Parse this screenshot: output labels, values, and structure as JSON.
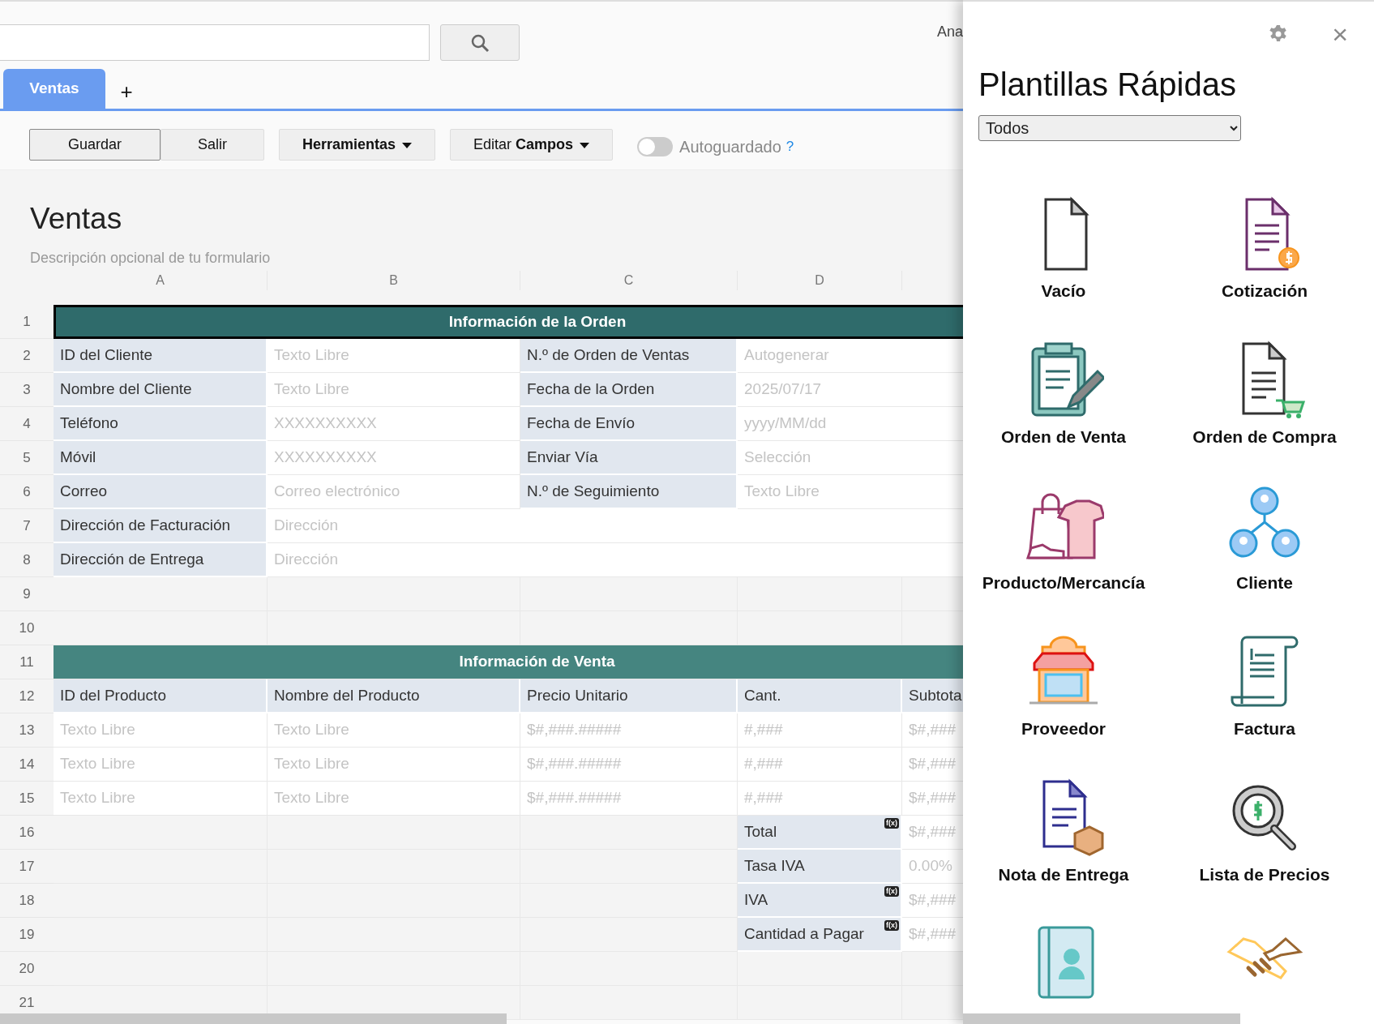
{
  "topbar": {
    "user": "Ana"
  },
  "tabs": [
    {
      "label": "Ventas",
      "selected": true
    }
  ],
  "add_tab": "+",
  "toolbar": [
    {
      "kind": "primary",
      "label": "Guardar"
    },
    {
      "kind": "plain",
      "label": "Salir"
    },
    {
      "kind": "dropdown",
      "label": "Herramientas"
    },
    {
      "kind": "dropdown-mixed",
      "label": "Editar **Campos**"
    }
  ],
  "autosave": {
    "label": "Autoguardado",
    "on": false,
    "help": "?"
  },
  "form": {
    "title": "Ventas",
    "description": "Descripción opcional de tu formulario"
  },
  "sheet": {
    "columns": [
      "A",
      "B",
      "C",
      "D",
      ""
    ],
    "rows": [
      {
        "number": "1",
        "cells": [
          {
            "kind": "section",
            "text": "Información de la Orden",
            "color": "#2f6b6b",
            "selected": true
          }
        ]
      },
      {
        "number": "2",
        "cells": [
          {
            "kind": "label",
            "text": "ID del Cliente"
          },
          {
            "kind": "input",
            "text": "Texto Libre"
          },
          {
            "kind": "label",
            "text": "N.º de Orden de Ventas"
          },
          {
            "kind": "wide_input",
            "text": "Autogenerar"
          }
        ]
      },
      {
        "number": "3",
        "cells": [
          {
            "kind": "label",
            "text": "Nombre del Cliente"
          },
          {
            "kind": "input",
            "text": "Texto Libre"
          },
          {
            "kind": "label",
            "text": "Fecha de la Orden"
          },
          {
            "kind": "wide_input",
            "text": "2025/07/17"
          }
        ]
      },
      {
        "number": "4",
        "cells": [
          {
            "kind": "label",
            "text": "Teléfono"
          },
          {
            "kind": "input",
            "text": "XXXXXXXXXX"
          },
          {
            "kind": "label",
            "text": "Fecha de Envío"
          },
          {
            "kind": "wide_input",
            "text": "yyyy/MM/dd"
          }
        ]
      },
      {
        "number": "5",
        "cells": [
          {
            "kind": "label",
            "text": "Móvil"
          },
          {
            "kind": "input",
            "text": "XXXXXXXXXX"
          },
          {
            "kind": "label",
            "text": "Enviar Vía"
          },
          {
            "kind": "wide_input",
            "text": "Selección"
          }
        ]
      },
      {
        "number": "6",
        "cells": [
          {
            "kind": "label",
            "text": "Correo"
          },
          {
            "kind": "input",
            "text": "Correo electrónico"
          },
          {
            "kind": "label",
            "text": "N.º de Seguimiento"
          },
          {
            "kind": "wide_input",
            "text": "Texto Libre"
          }
        ]
      },
      {
        "number": "7",
        "cells": [
          {
            "kind": "label",
            "text": "Dirección de Facturación"
          },
          {
            "kind": "wide_input",
            "text": "Dirección"
          }
        ]
      },
      {
        "number": "8",
        "cells": [
          {
            "kind": "label",
            "text": "Dirección de Entrega"
          },
          {
            "kind": "wide_input",
            "text": "Dirección"
          }
        ]
      },
      {
        "number": "9",
        "cells": []
      },
      {
        "number": "10",
        "cells": []
      },
      {
        "number": "11",
        "cells": [
          {
            "kind": "section",
            "text": "Información de Venta",
            "color": "#458580",
            "selected": false
          }
        ]
      },
      {
        "number": "12",
        "cells": [
          {
            "kind": "label",
            "text": "ID del Producto"
          },
          {
            "kind": "label",
            "text": "Nombre del Producto"
          },
          {
            "kind": "label",
            "text": "Precio Unitario"
          },
          {
            "kind": "label",
            "text": "Cant."
          },
          {
            "kind": "label",
            "text": "Subtota"
          }
        ]
      },
      {
        "number": "13",
        "cells": [
          {
            "kind": "input",
            "text": "Texto Libre"
          },
          {
            "kind": "input",
            "text": "Texto Libre"
          },
          {
            "kind": "input",
            "text": "$#,###.#####"
          },
          {
            "kind": "input",
            "text": "#,###"
          },
          {
            "kind": "input",
            "text": "$#,###"
          }
        ]
      },
      {
        "number": "14",
        "cells": [
          {
            "kind": "input",
            "text": "Texto Libre"
          },
          {
            "kind": "input",
            "text": "Texto Libre"
          },
          {
            "kind": "input",
            "text": "$#,###.#####"
          },
          {
            "kind": "input",
            "text": "#,###"
          },
          {
            "kind": "input",
            "text": "$#,###"
          }
        ]
      },
      {
        "number": "15",
        "cells": [
          {
            "kind": "input",
            "text": "Texto Libre"
          },
          {
            "kind": "input",
            "text": "Texto Libre"
          },
          {
            "kind": "input",
            "text": "$#,###.#####"
          },
          {
            "kind": "input",
            "text": "#,###"
          },
          {
            "kind": "input",
            "text": "$#,###"
          }
        ]
      },
      {
        "number": "16",
        "cells": [
          {
            "kind": "empty"
          },
          {
            "kind": "empty"
          },
          {
            "kind": "empty"
          },
          {
            "kind": "label",
            "text": "Total",
            "formula": "f(x)"
          },
          {
            "kind": "input",
            "text": "$#,###"
          }
        ]
      },
      {
        "number": "17",
        "cells": [
          {
            "kind": "empty"
          },
          {
            "kind": "empty"
          },
          {
            "kind": "empty"
          },
          {
            "kind": "label",
            "text": "Tasa IVA"
          },
          {
            "kind": "input",
            "text": "0.00%"
          }
        ]
      },
      {
        "number": "18",
        "cells": [
          {
            "kind": "empty"
          },
          {
            "kind": "empty"
          },
          {
            "kind": "empty"
          },
          {
            "kind": "label",
            "text": "IVA",
            "formula": "f(x)"
          },
          {
            "kind": "input",
            "text": "$#,###"
          }
        ]
      },
      {
        "number": "19",
        "cells": [
          {
            "kind": "empty"
          },
          {
            "kind": "empty"
          },
          {
            "kind": "empty"
          },
          {
            "kind": "label",
            "text": "Cantidad a Pagar",
            "formula": "f(x)"
          },
          {
            "kind": "input",
            "text": "$#,###"
          }
        ]
      },
      {
        "number": "20",
        "cells": []
      },
      {
        "number": "21",
        "cells": []
      }
    ]
  },
  "panel": {
    "close": "×",
    "title": "Plantillas Rápidas",
    "filter": "Todos",
    "templates": [
      {
        "kind": "blank",
        "label": "Vacío"
      },
      {
        "kind": "quote",
        "label": "Cotización"
      },
      {
        "kind": "sales-order",
        "label": "Orden de Venta"
      },
      {
        "kind": "purchase-order",
        "label": "Orden de Compra"
      },
      {
        "kind": "product",
        "label": "Producto/Mercancía"
      },
      {
        "kind": "customer",
        "label": "Cliente"
      },
      {
        "kind": "supplier",
        "label": "Proveedor"
      },
      {
        "kind": "invoice",
        "label": "Factura"
      },
      {
        "kind": "delivery",
        "label": "Nota de Entrega"
      },
      {
        "kind": "price-list",
        "label": "Lista de Precios"
      },
      {
        "kind": "contacts"
      },
      {
        "kind": "deal"
      }
    ]
  }
}
